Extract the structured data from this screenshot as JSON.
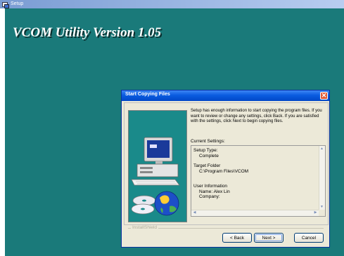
{
  "window": {
    "title": "Setup",
    "icon": "setup-icon"
  },
  "banner": {
    "title": "VCOM Utility Version 1.05"
  },
  "dialog": {
    "title": "Start Copying Files",
    "close_icon": "close-icon",
    "message": "Setup has enough information to start copying the program files. If you want to review or change any settings, click Back.  If you are satisfied with the settings, click Next to begin copying files.",
    "current_settings_label": "Current Settings:",
    "settings": {
      "setup_type_label": "Setup Type:",
      "setup_type_value": "Complete",
      "target_folder_label": "Target Folder",
      "target_folder_value": "C:\\Program Files\\VCOM",
      "user_info_label": "User Information",
      "name_line": "Name:  Alex Lin",
      "company_line": "Company:"
    },
    "branding": "InstallShield",
    "buttons": {
      "back": "< Back",
      "next": "Next >",
      "cancel": "Cancel"
    }
  },
  "colors": {
    "background": "#1a7a7a",
    "titlebar": "#0a5ce0",
    "dialog_face": "#ece9d8",
    "close_button": "#e35a37"
  }
}
